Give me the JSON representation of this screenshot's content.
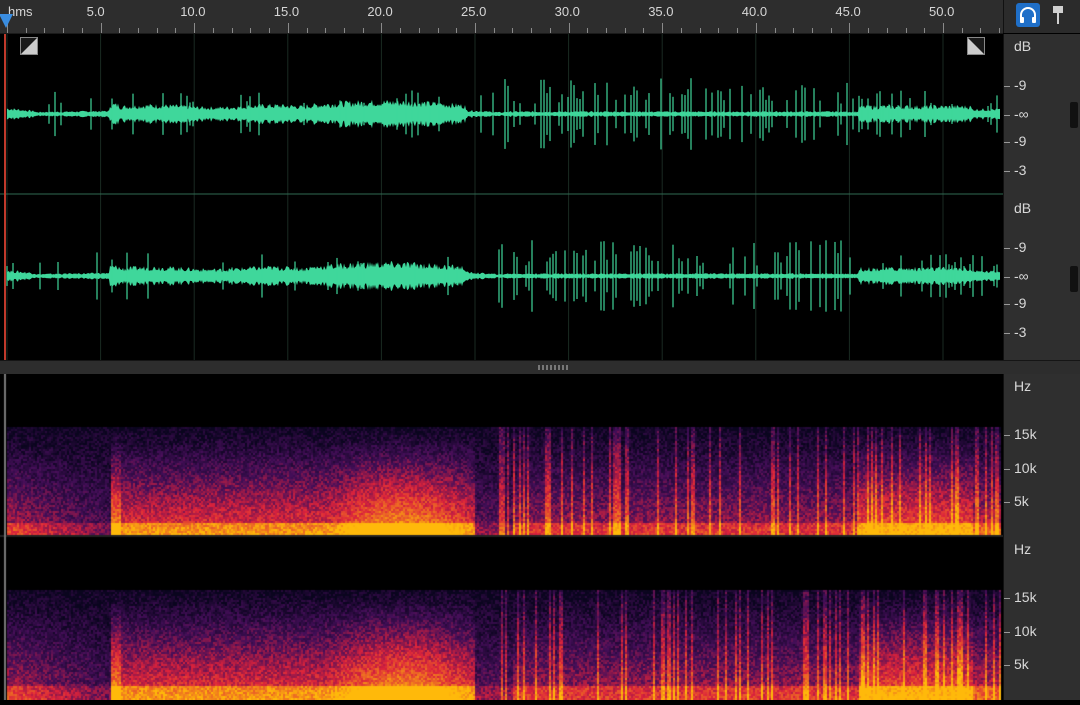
{
  "ruler": {
    "unit_label": "hms",
    "labels": [
      "5.0",
      "10.0",
      "15.0",
      "20.0",
      "25.0",
      "30.0",
      "35.0",
      "40.0",
      "45.0",
      "50.0"
    ]
  },
  "toolbar": {
    "headphones_icon": "headphones-icon",
    "pin_icon": "pin-icon"
  },
  "waveform": {
    "channels": [
      {
        "scale_unit": "dB",
        "scale_labels": [
          "-9",
          "-∞",
          "-9",
          "-3"
        ]
      },
      {
        "scale_unit": "dB",
        "scale_labels": [
          "-9",
          "-∞",
          "-9",
          "-3"
        ]
      }
    ],
    "color": "#3fd79b",
    "duration_seconds": 53.5
  },
  "spectrogram": {
    "channels": [
      {
        "scale_unit": "Hz",
        "scale_labels": [
          "15k",
          "10k",
          "5k"
        ]
      },
      {
        "scale_unit": "Hz",
        "scale_labels": [
          "15k",
          "10k",
          "5k"
        ]
      }
    ]
  },
  "colors": {
    "accent": "#1f6fc8",
    "playhead": "#3a8de0",
    "cursor_line": "#c0392b",
    "panel": "#2d2d2d"
  }
}
